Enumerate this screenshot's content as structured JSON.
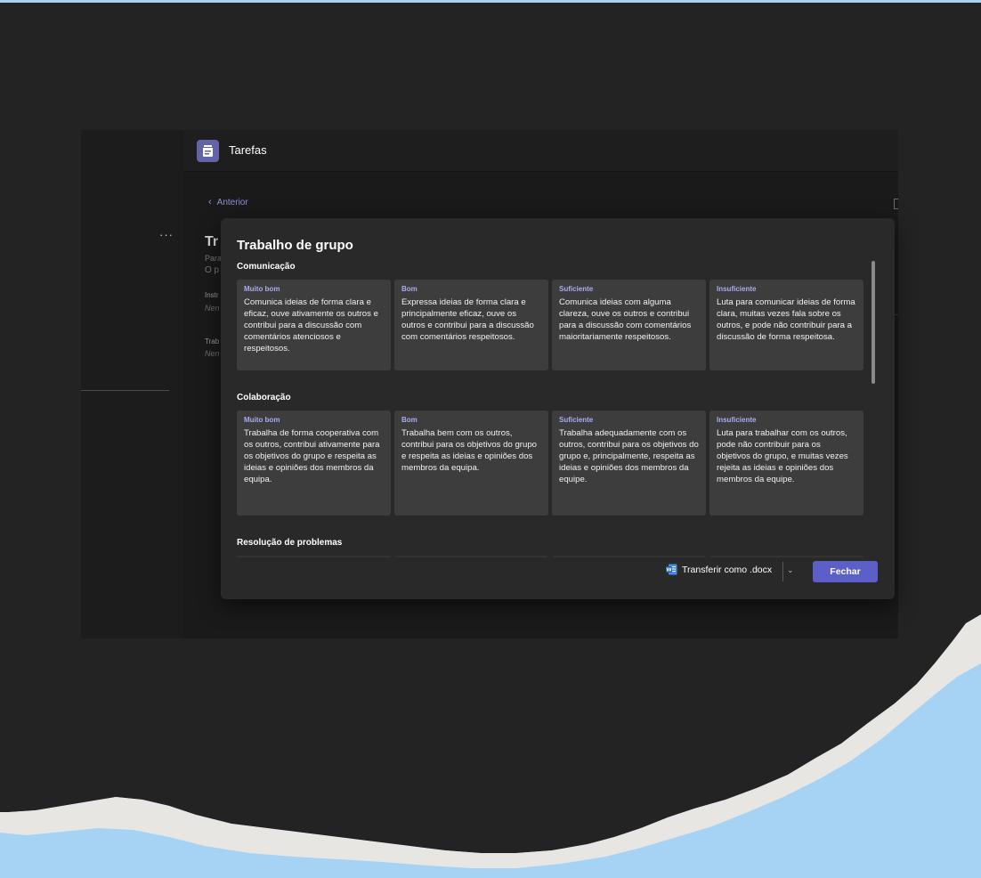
{
  "window": {
    "app_title": "Tarefas",
    "rail_more": "···"
  },
  "background_page": {
    "back_label": "Anterior",
    "title_fragment": "Tr",
    "subtitle_1": "Para",
    "subtitle_2": "O p",
    "label_1": "Instr",
    "value_1": "Nen",
    "label_2": "Trab",
    "value_2": "Nen"
  },
  "dialog": {
    "title": "Trabalho de grupo",
    "sections": [
      {
        "name": "Comunicação",
        "criteria": [
          {
            "level": "Muito bom",
            "text": "Comunica ideias de forma clara e eficaz, ouve ativamente os outros e contribui para a discussão com comentários atenciosos e respeitosos."
          },
          {
            "level": "Bom",
            "text": "Expressa ideias de forma clara e principalmente eficaz, ouve os outros e contribui para a discussão com comentários respeitosos."
          },
          {
            "level": "Suficiente",
            "text": "Comunica ideias com alguma clareza, ouve os outros e contribui para a discussão com comentários maioritariamente respeitosos."
          },
          {
            "level": "Insuficiente",
            "text": "Luta para comunicar ideias de forma clara, muitas vezes fala sobre os outros, e pode não contribuir para a discussão de forma respeitosa."
          }
        ]
      },
      {
        "name": "Colaboração",
        "criteria": [
          {
            "level": "Muito bom",
            "text": "Trabalha de forma cooperativa com os outros, contribui ativamente para os objetivos do grupo e respeita as ideias e opiniões dos membros da equipa."
          },
          {
            "level": "Bom",
            "text": "Trabalha bem com os outros, contribui para os objetivos do grupo e respeita as ideias e opiniões dos membros da equipa."
          },
          {
            "level": "Suficiente",
            "text": "Trabalha adequadamente com os outros, contribui para os objetivos do grupo e, principalmente, respeita as ideias e opiniões dos membros da equipe."
          },
          {
            "level": "Insuficiente",
            "text": "Luta para trabalhar com os outros, pode não contribuir para os objetivos do grupo, e muitas vezes rejeita as ideias e opiniões dos membros da equipe."
          }
        ]
      },
      {
        "name": "Resolução de problemas"
      }
    ],
    "download_label": "Transferir como .docx",
    "close_label": "Fechar"
  },
  "colors": {
    "accent": "#5b5fc7",
    "level_label": "#a9abf2",
    "card_bg": "#3d3d3d",
    "dialog_bg": "#292929",
    "sky": "#a6d3f3"
  },
  "icons": [
    "tasks-app-icon",
    "chevron-left-icon",
    "word-document-icon",
    "chevron-down-icon",
    "more-icon"
  ]
}
